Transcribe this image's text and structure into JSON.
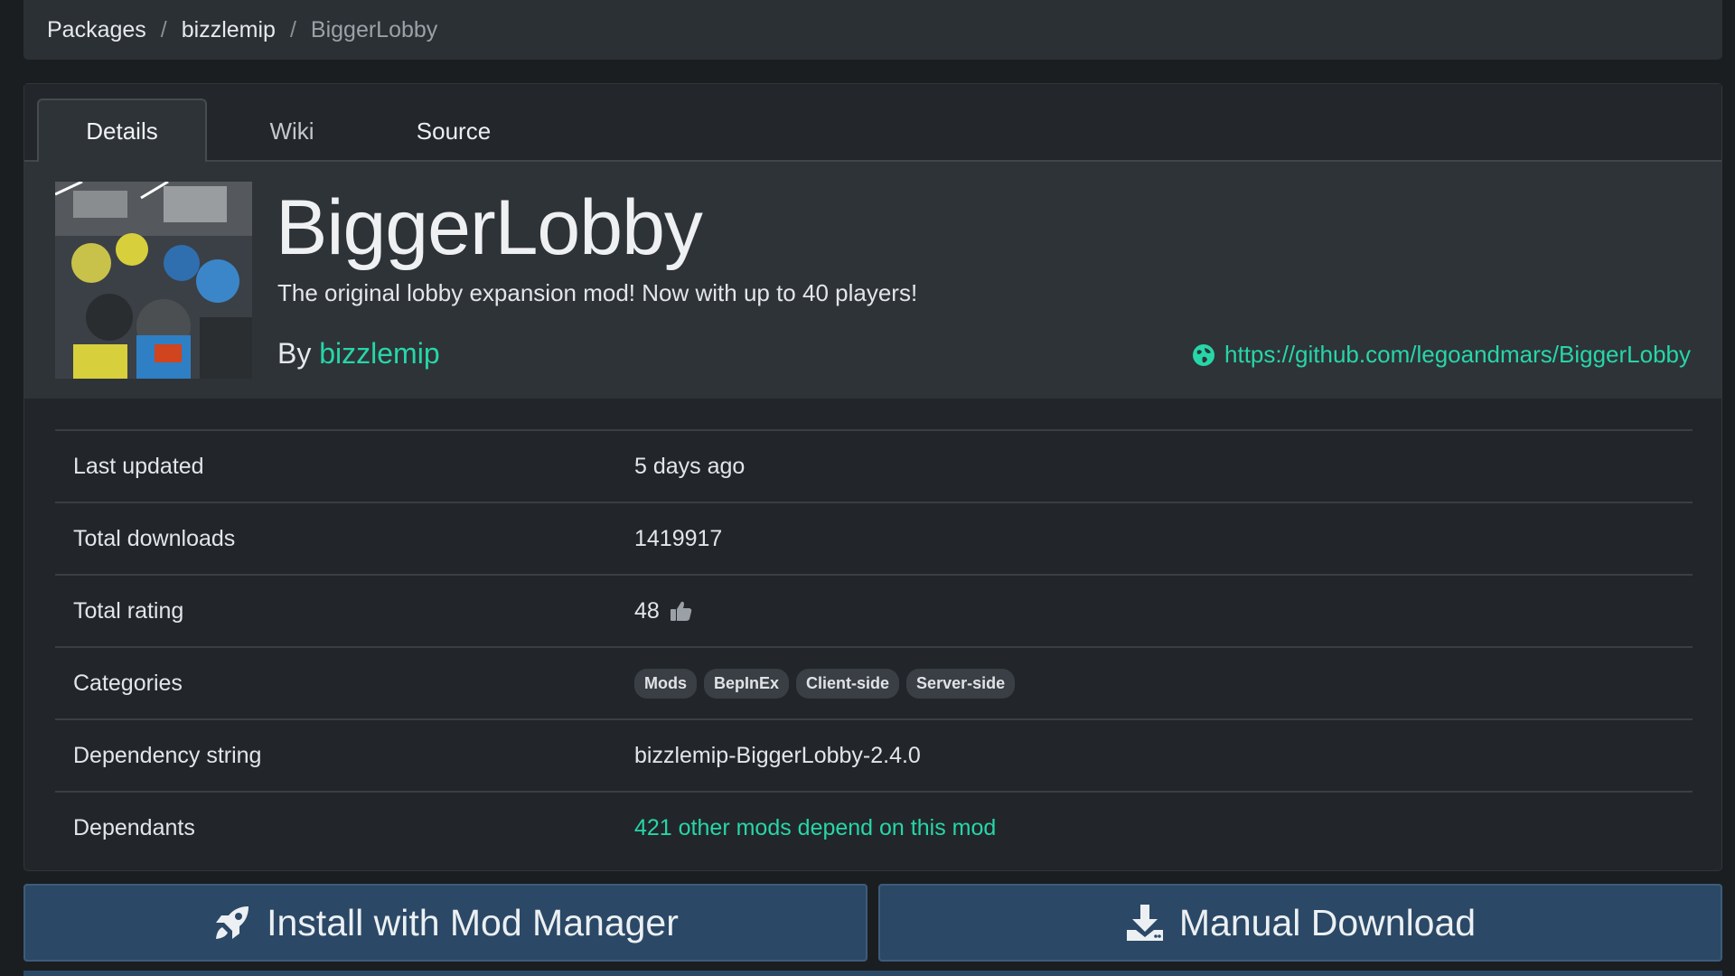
{
  "breadcrumb": {
    "items": [
      "Packages",
      "bizzlemip",
      "BiggerLobby"
    ],
    "separator": "/"
  },
  "tabs": [
    {
      "label": "Details",
      "active": true
    },
    {
      "label": "Wiki",
      "active": false
    },
    {
      "label": "Source",
      "active": false
    }
  ],
  "package": {
    "title": "BiggerLobby",
    "description": "The original lobby expansion mod! Now with up to 40 players!",
    "by_label": "By",
    "author": "bizzlemip",
    "website": "https://github.com/legoandmars/BiggerLobby",
    "thumbnail_icon": "package-thumbnail"
  },
  "details": {
    "last_updated_label": "Last updated",
    "last_updated_value": "5 days ago",
    "downloads_label": "Total downloads",
    "downloads_value": "1419917",
    "rating_label": "Total rating",
    "rating_value": "48",
    "rating_icon": "thumbs-up-icon",
    "categories_label": "Categories",
    "categories": [
      "Mods",
      "BepInEx",
      "Client-side",
      "Server-side"
    ],
    "dependency_label": "Dependency string",
    "dependency_value": "bizzlemip-BiggerLobby-2.4.0",
    "dependants_label": "Dependants",
    "dependants_value": "421 other mods depend on this mod"
  },
  "actions": {
    "install_label": "Install with Mod Manager",
    "download_label": "Manual Download"
  },
  "colors": {
    "accent": "#27d6a8",
    "button_bg": "#2b4966",
    "page_bg": "#1b1e21"
  }
}
